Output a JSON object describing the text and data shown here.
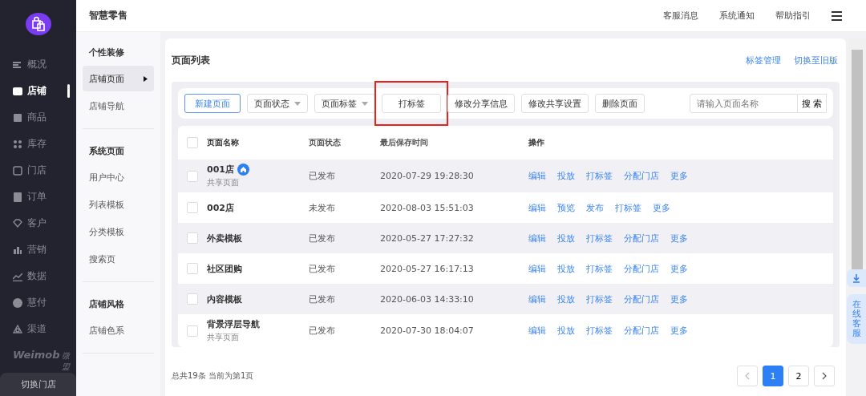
{
  "nav": {
    "items": [
      {
        "label": "概况",
        "selected": false
      },
      {
        "label": "店铺",
        "selected": true
      },
      {
        "label": "商品",
        "selected": false
      },
      {
        "label": "库存",
        "selected": false
      },
      {
        "label": "门店",
        "selected": false
      },
      {
        "label": "订单",
        "selected": false
      },
      {
        "label": "客户",
        "selected": false
      },
      {
        "label": "营销",
        "selected": false
      },
      {
        "label": "数据",
        "selected": false
      },
      {
        "label": "慧付",
        "selected": false
      },
      {
        "label": "渠道",
        "selected": false
      }
    ],
    "brand": {
      "name": "Weimob",
      "suffix": "微盟"
    },
    "switch_store": "切换门店"
  },
  "app_title": "智慧零售",
  "header_links": [
    "客服消息",
    "系统通知",
    "帮助指引"
  ],
  "submenu": [
    {
      "title": "个性装修",
      "items": [
        {
          "label": "店铺页面",
          "selected": true
        },
        {
          "label": "店铺导航",
          "selected": false
        }
      ]
    },
    {
      "title": "系统页面",
      "items": [
        {
          "label": "用户中心",
          "selected": false
        },
        {
          "label": "列表模板",
          "selected": false
        },
        {
          "label": "分类模板",
          "selected": false
        },
        {
          "label": "搜索页",
          "selected": false
        }
      ]
    },
    {
      "title": "店铺风格",
      "items": [
        {
          "label": "店铺色系",
          "selected": false
        }
      ]
    }
  ],
  "card": {
    "title": "页面列表",
    "links": [
      "标签管理",
      "切换至旧版"
    ]
  },
  "toolbar": {
    "buttons": [
      {
        "label": "新建页面",
        "kind": "primary",
        "highlighted": false
      },
      {
        "label": "页面状态",
        "kind": "dropdown",
        "highlighted": false
      },
      {
        "label": "页面标签",
        "kind": "dropdown",
        "highlighted": false
      },
      {
        "label": "打标签",
        "kind": "button",
        "highlighted": true
      },
      {
        "label": "修改分享信息",
        "kind": "button",
        "highlighted": false
      },
      {
        "label": "修改共享设置",
        "kind": "button",
        "highlighted": false
      },
      {
        "label": "删除页面",
        "kind": "button",
        "highlighted": false
      }
    ],
    "search": {
      "placeholder": "请输入页面名称",
      "button": "搜 索"
    }
  },
  "table": {
    "all_checked": false,
    "columns": [
      "页面名称",
      "页面状态",
      "最后保存时间",
      "操作"
    ],
    "rows": [
      {
        "name": "001店",
        "home": true,
        "subtitle": "共享页面",
        "status": "已发布",
        "time": "2020-07-29 19:28:30",
        "actions": [
          "编辑",
          "投放",
          "打标签",
          "分配门店",
          "更多"
        ],
        "checked": false
      },
      {
        "name": "002店",
        "home": false,
        "status": "未发布",
        "time": "2020-08-03 15:51:03",
        "actions": [
          "编辑",
          "预览",
          "发布",
          "打标签",
          "更多"
        ],
        "checked": false
      },
      {
        "name": "外卖模板",
        "home": false,
        "status": "已发布",
        "time": "2020-05-27 17:27:32",
        "actions": [
          "编辑",
          "投放",
          "打标签",
          "分配门店",
          "更多"
        ],
        "checked": false
      },
      {
        "name": "社区团购",
        "home": false,
        "status": "已发布",
        "time": "2020-05-27 16:17:13",
        "actions": [
          "编辑",
          "投放",
          "打标签",
          "分配门店",
          "更多"
        ],
        "checked": false
      },
      {
        "name": "内容模板",
        "home": false,
        "status": "已发布",
        "time": "2020-06-03 14:33:10",
        "actions": [
          "编辑",
          "投放",
          "打标签",
          "分配门店",
          "更多"
        ],
        "checked": false
      },
      {
        "name": "背景浮层导航",
        "home": false,
        "subtitle": "共享页面",
        "status": "已发布",
        "time": "2020-07-30 18:04:07",
        "actions": [
          "编辑",
          "投放",
          "打标签",
          "分配门店",
          "更多"
        ],
        "checked": false
      }
    ]
  },
  "footer": {
    "summary": "总共19条 当前为第1页",
    "pages": [
      {
        "label": "1",
        "selected": true
      },
      {
        "label": "2",
        "selected": false
      }
    ]
  },
  "float": {
    "service": "在线客服"
  }
}
